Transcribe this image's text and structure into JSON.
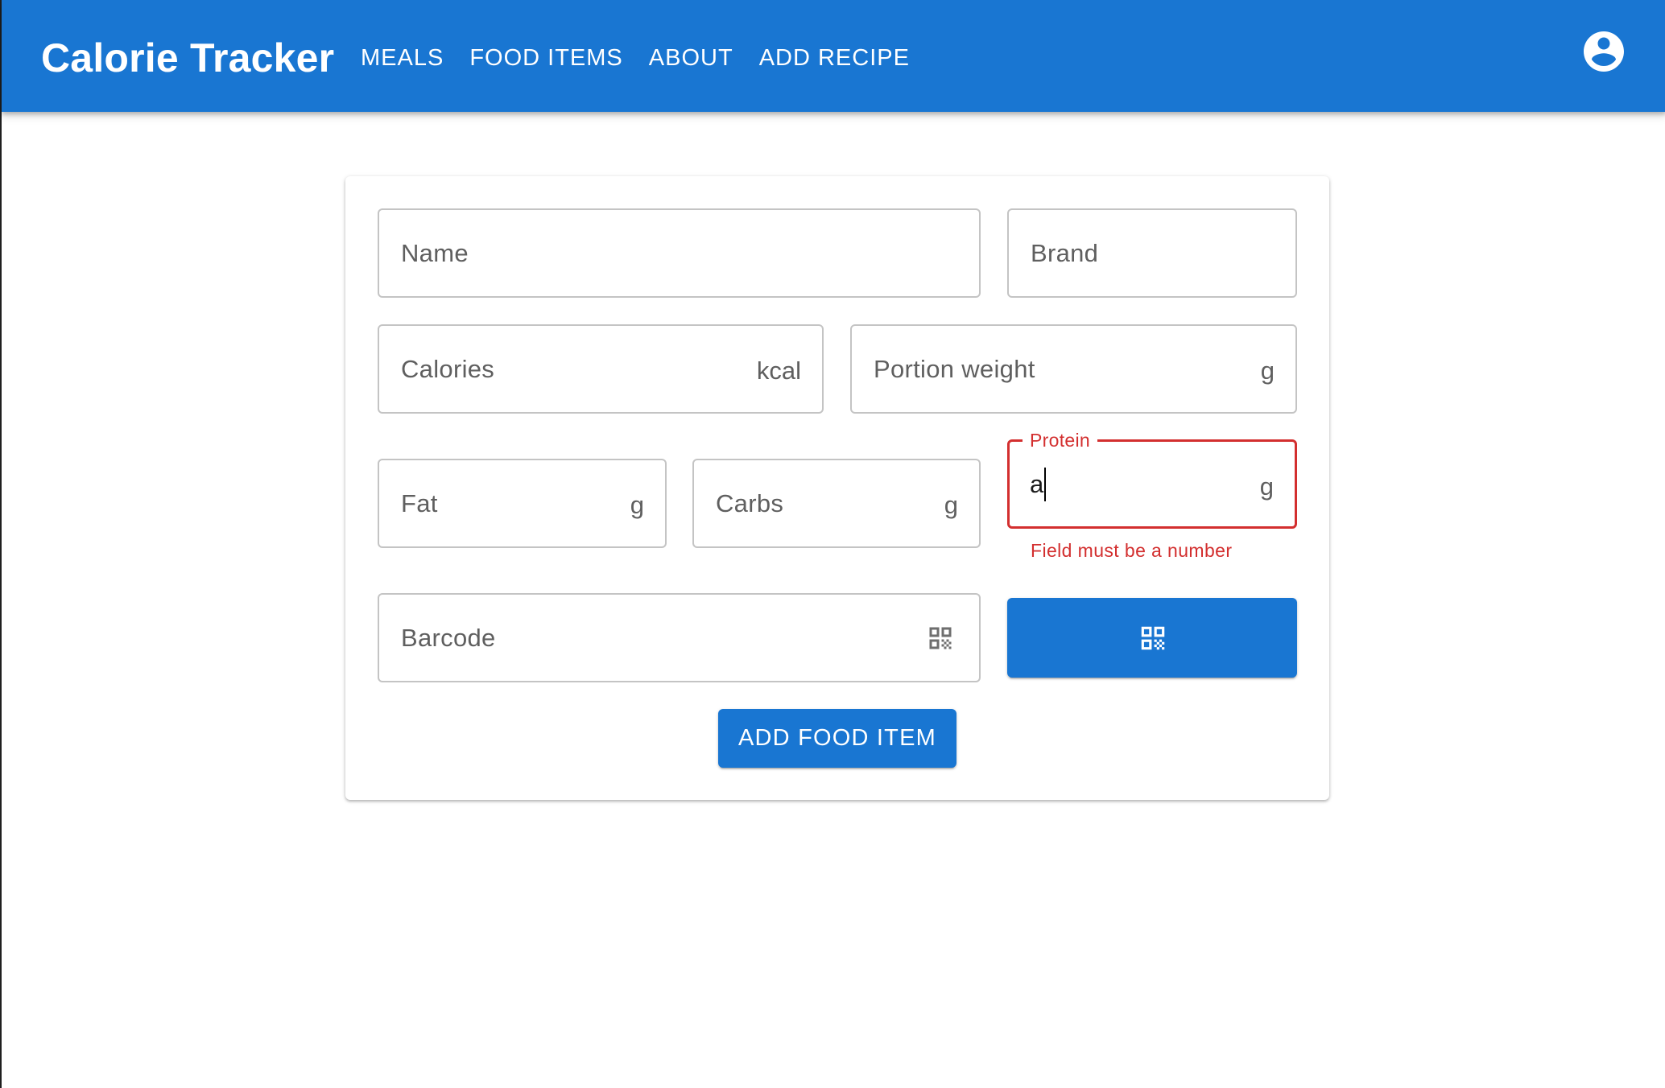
{
  "header": {
    "title": "Calorie Tracker",
    "nav": [
      "MEALS",
      "FOOD ITEMS",
      "ABOUT",
      "ADD RECIPE"
    ],
    "account_icon": "account-circle-icon"
  },
  "form": {
    "name": {
      "placeholder": "Name"
    },
    "brand": {
      "placeholder": "Brand"
    },
    "calories": {
      "placeholder": "Calories",
      "unit": "kcal"
    },
    "portion_weight": {
      "placeholder": "Portion weight",
      "unit": "g"
    },
    "fat": {
      "placeholder": "Fat",
      "unit": "g"
    },
    "carbs": {
      "placeholder": "Carbs",
      "unit": "g"
    },
    "protein": {
      "label": "Protein",
      "value": "a",
      "unit": "g",
      "error": "Field must be a number"
    },
    "barcode": {
      "placeholder": "Barcode",
      "icon": "qr-code-icon"
    },
    "scan_button_icon": "qr-code-icon",
    "submit_label": "ADD FOOD ITEM"
  },
  "colors": {
    "primary": "#1976d2",
    "error": "#d32f2f",
    "border": "#c4c4c4"
  }
}
